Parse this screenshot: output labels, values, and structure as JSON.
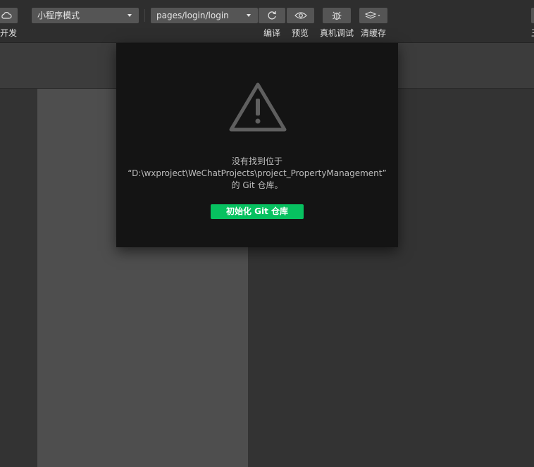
{
  "toolbar": {
    "left_label": "开发",
    "mode_select": "小程序模式",
    "page_select": "pages/login/login",
    "compile_label": "编译",
    "preview_label": "预览",
    "device_debug_label": "真机调试",
    "clear_cache_label": "清缓存",
    "right_cut_label": "王"
  },
  "dialog": {
    "line1": "没有找到位于",
    "line2": "“D:\\wxproject\\WeChatProjects\\project_PropertyManagement”",
    "line3": "的 Git 仓库。",
    "init_button": "初始化 Git 仓库"
  },
  "colors": {
    "primary_button": "#07c160",
    "dialog_bg": "#141414",
    "toolbar_bg": "#2e2e2e",
    "simulator_bg": "#4e4e4e"
  }
}
